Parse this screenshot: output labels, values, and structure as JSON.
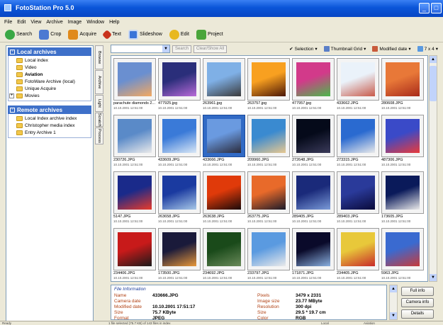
{
  "window": {
    "title": "FotoStation Pro 5.0"
  },
  "menu": [
    "File",
    "Edit",
    "View",
    "Archive",
    "Image",
    "Window",
    "Help"
  ],
  "toolbar": [
    {
      "label": "Search",
      "icon": "search-icon",
      "color": "#3aa845"
    },
    {
      "label": "Crop",
      "icon": "crop-icon",
      "color": "#4c7ad2"
    },
    {
      "label": "Acquire",
      "icon": "acquire-icon",
      "color": "#e08a1c"
    },
    {
      "label": "Text",
      "icon": "text-icon",
      "color": "#c8321c"
    },
    {
      "label": "Slideshow",
      "icon": "slideshow-icon",
      "color": "#3a74d8"
    },
    {
      "label": "Edit",
      "icon": "edit-icon",
      "color": "#e8b81e"
    },
    {
      "label": "Project",
      "icon": "project-icon",
      "color": "#4aa53b"
    }
  ],
  "local_archives": {
    "heading": "Local archives",
    "items": [
      "Local index",
      "Video",
      "Aviation",
      "FotoWare Archive (local)",
      "Unique Acquire",
      "Movies"
    ]
  },
  "remote_archives": {
    "heading": "Remote archives",
    "items": [
      "Local Index archive index",
      "Christopher media index",
      "Entry Archive 1"
    ]
  },
  "vertical_tabs": [
    "Browse",
    "Archive",
    "Light",
    "Scratch",
    "Process"
  ],
  "search": {
    "search_button": "Search",
    "clear_button": "Clear/Show All",
    "selection_label": "Selection",
    "view_label": "Thumbnail Grid",
    "sort_label": "Modified date",
    "pager_label": "7 x 4"
  },
  "thumbnails": [
    {
      "name": "parachute diamonds 2...",
      "date": "10.10.2001 12:51:00",
      "colors": [
        "#6a8fd0",
        "#f4a860"
      ]
    },
    {
      "name": "477925.jpg",
      "date": "10.10.2001 12:51:00",
      "colors": [
        "#2a2e7a",
        "#b86ad8"
      ]
    },
    {
      "name": "263961.jpg",
      "date": "10.10.2001 12:51:00",
      "colors": [
        "#7fb0e6",
        "#3a3a3a"
      ]
    },
    {
      "name": "263757.jpg",
      "date": "10.10.2001 12:51:00",
      "colors": [
        "#f8a020",
        "#4a1606"
      ]
    },
    {
      "name": "477957.jpg",
      "date": "10.10.2001 12:51:00",
      "colors": [
        "#d23a8a",
        "#4ab84a"
      ]
    },
    {
      "name": "433662.JPG",
      "date": "10.10.2001 12:51:00",
      "colors": [
        "#eaf2fa",
        "#c85a4a"
      ]
    },
    {
      "name": "280608.JPG",
      "date": "10.10.2001 12:51:00",
      "colors": [
        "#e87838",
        "#a82a1a"
      ]
    },
    {
      "name": "230726.JPG",
      "date": "10.10.2001 12:51:00",
      "colors": [
        "#5a8ac8",
        "#eaeaea"
      ]
    },
    {
      "name": "433609.JPG",
      "date": "10.10.2001 12:51:00",
      "colors": [
        "#3a7ad8",
        "#dae8f6"
      ]
    },
    {
      "name": "433666.JPG",
      "date": "10.10.2001 12:51:00",
      "colors": [
        "#6a9ae0",
        "#2a2a3a"
      ]
    },
    {
      "name": "209960.JPG",
      "date": "10.10.2001 12:51:00",
      "colors": [
        "#3a8ad0",
        "#e8c890"
      ]
    },
    {
      "name": "272648.JPG",
      "date": "10.10.2001 12:51:00",
      "colors": [
        "#050a1a",
        "#3a3a5a"
      ]
    },
    {
      "name": "273315.JPG",
      "date": "10.10.2001 12:51:00",
      "colors": [
        "#2a6ad0",
        "#eaeaea"
      ]
    },
    {
      "name": "487306.JPG",
      "date": "10.10.2001 12:51:00",
      "colors": [
        "#3a4ac8",
        "#ea3a3a"
      ]
    },
    {
      "name": "5147.JPG",
      "date": "10.10.2001 12:51:00",
      "colors": [
        "#1a2a8a",
        "#ea3a2a"
      ]
    },
    {
      "name": "263658.JPG",
      "date": "10.10.2001 12:51:00",
      "colors": [
        "#1a3aa0",
        "#a8c8e8"
      ]
    },
    {
      "name": "263638.JPG",
      "date": "10.10.2001 12:51:00",
      "colors": [
        "#e03a0a",
        "#1a0a0a"
      ]
    },
    {
      "name": "263775.JPG",
      "date": "10.10.2001 12:51:00",
      "colors": [
        "#e86a2a",
        "#1a1a2a"
      ]
    },
    {
      "name": "289405.JPG",
      "date": "10.10.2001 12:51:00",
      "colors": [
        "#1a2a7a",
        "#7a9ad8"
      ]
    },
    {
      "name": "289403.JPG",
      "date": "10.10.2001 12:51:00",
      "colors": [
        "#2a3a9a",
        "#0a0a3a"
      ]
    },
    {
      "name": "173605.JPG",
      "date": "10.10.2001 12:51:00",
      "colors": [
        "#0a1a5a",
        "#eaeaea"
      ]
    },
    {
      "name": "234406.JPG",
      "date": "10.10.2001 12:51:00",
      "colors": [
        "#c81a1a",
        "#1a1a1a"
      ]
    },
    {
      "name": "173500.JPG",
      "date": "10.10.2001 12:51:00",
      "colors": [
        "#1a1a3a",
        "#e8983a"
      ]
    },
    {
      "name": "234692.JPG",
      "date": "10.10.2001 12:51:00",
      "colors": [
        "#1a4a1a",
        "#6a8a5a"
      ]
    },
    {
      "name": "233797.JPG",
      "date": "10.10.2001 12:51:00",
      "colors": [
        "#5a9ae0",
        "#eaeaea"
      ]
    },
    {
      "name": "171871.JPG",
      "date": "10.10.2001 12:51:00",
      "colors": [
        "#0a0a2a",
        "#8ab0e0"
      ]
    },
    {
      "name": "234405.JPG",
      "date": "10.10.2001 12:51:00",
      "colors": [
        "#e8c83a",
        "#c82a2a"
      ]
    },
    {
      "name": "5963.JPG",
      "date": "10.10.2001 12:51:00",
      "colors": [
        "#3a6ad0",
        "#c83a3a"
      ]
    }
  ],
  "selected_index": 9,
  "file_info": {
    "title": "File Information",
    "left": [
      {
        "key": "Name",
        "value": "433666.JPG"
      },
      {
        "key": "Camera date",
        "value": ""
      },
      {
        "key": "Modified date",
        "value": "10.10.2001 17:51:17"
      },
      {
        "key": "Size",
        "value": "75.7 KByte"
      },
      {
        "key": "Format",
        "value": "JPEG"
      }
    ],
    "right": [
      {
        "key": "Pixels",
        "value": "3479 x 2331"
      },
      {
        "key": "Image size",
        "value": "23.77 MByte"
      },
      {
        "key": "Resolution",
        "value": "300 dpi"
      },
      {
        "key": "Size",
        "value": "29.5 * 19.7 cm"
      },
      {
        "key": "Color",
        "value": "RGB"
      }
    ]
  },
  "info_buttons": [
    "Full info",
    "Camera info",
    "Details"
  ],
  "status": [
    "Ready",
    "1 file selected (75.7 KB) of 143 files in index",
    "Local",
    "Aviation"
  ]
}
